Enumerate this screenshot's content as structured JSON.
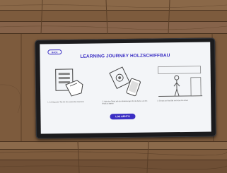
{
  "screen": {
    "back_label": "BACK",
    "title": "LEARNING JOURNEY HOLZSCHIFFBAU",
    "cta_label": "LOS GEHT'S",
    "accent_color": "#3b2fc4"
  },
  "steps": [
    {
      "icon": "hand-tablet-icon",
      "caption": "1. Auf folgenden Tab-Sie den passenden Abschnitt"
    },
    {
      "icon": "phone-nfc-icon",
      "caption": "2. Halte das Tablet auf den Markierungen für die Karte, um den Inhalt zu starten"
    },
    {
      "icon": "person-standing-icon",
      "caption": "3. Schaue auf das Bild und höre den Inhalt"
    }
  ]
}
